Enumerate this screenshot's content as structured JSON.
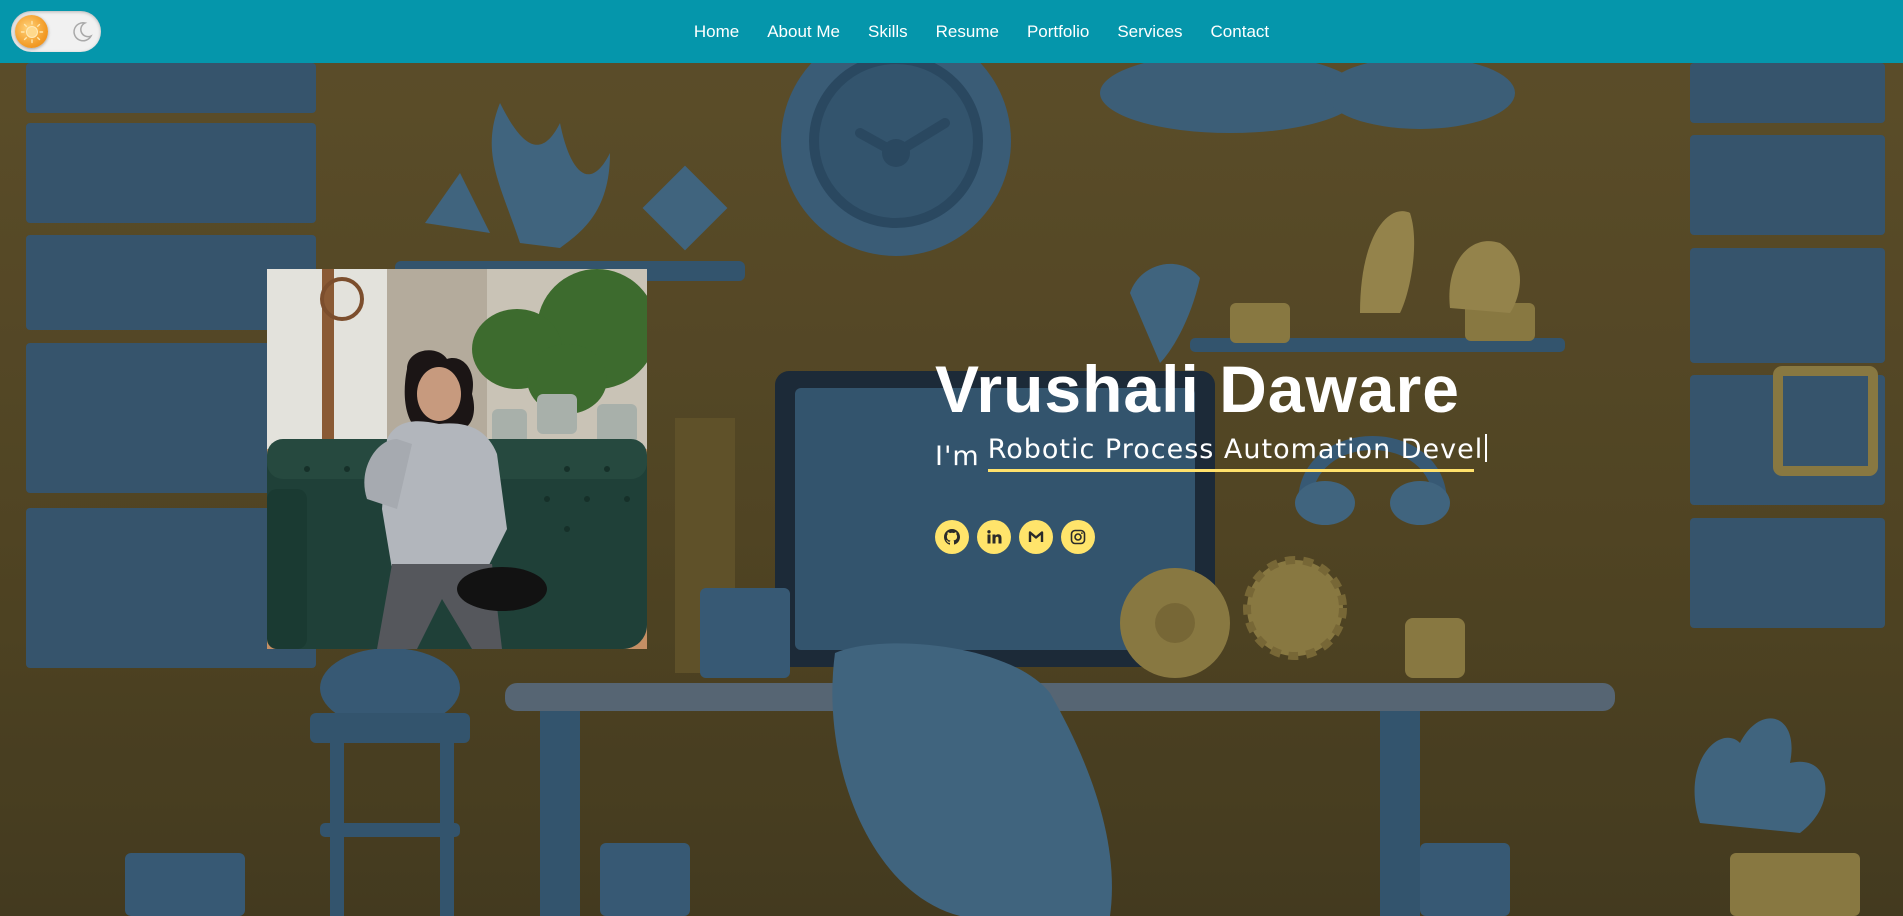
{
  "header": {
    "theme_toggle": {
      "state": "light",
      "sun_icon": "sun-icon",
      "moon_icon": "moon-icon"
    },
    "nav": [
      {
        "label": "Home"
      },
      {
        "label": "About Me"
      },
      {
        "label": "Skills"
      },
      {
        "label": "Resume"
      },
      {
        "label": "Portfolio"
      },
      {
        "label": "Services"
      },
      {
        "label": "Contact"
      }
    ]
  },
  "hero": {
    "name": "Vrushali Daware",
    "role_prefix": "I'm",
    "role_typed": "Robotic Process Automation Devel",
    "socials": [
      {
        "icon": "github-icon"
      },
      {
        "icon": "linkedin-icon"
      },
      {
        "icon": "gmail-icon"
      },
      {
        "icon": "instagram-icon"
      }
    ]
  },
  "colors": {
    "header_bg": "#0596ab",
    "accent_yellow": "#ffe46b",
    "scene_blue": "#3f6a8c",
    "scene_olive": "#6a5a30"
  }
}
